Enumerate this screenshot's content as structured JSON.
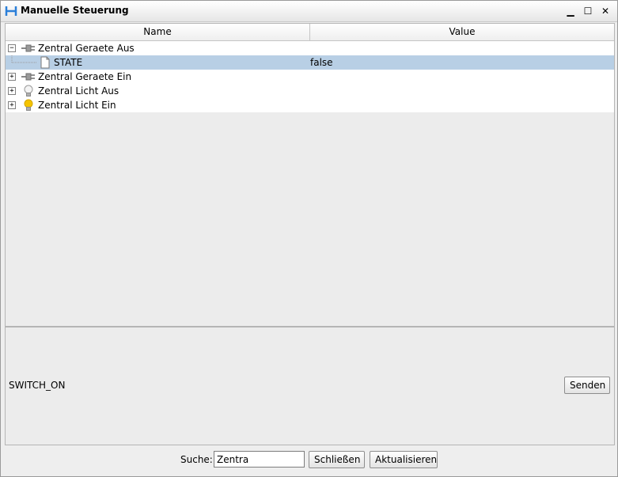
{
  "window": {
    "title": "Manuelle Steuerung",
    "minimize": "▁",
    "maximize": "☐",
    "close": "✕"
  },
  "table": {
    "columns": [
      "Name",
      "Value"
    ],
    "rows": [
      {
        "label": "Zentral Geraete Aus",
        "toggle": "−",
        "icon": "plug-icon",
        "value": ""
      },
      {
        "label": "STATE",
        "toggle": "",
        "icon": "document-icon",
        "value": "false",
        "selected": true
      },
      {
        "label": "Zentral Geraete Ein",
        "toggle": "+",
        "icon": "plug-icon",
        "value": ""
      },
      {
        "label": "Zentral Licht Aus",
        "toggle": "+",
        "icon": "bulb-off-icon",
        "value": ""
      },
      {
        "label": "Zentral Licht Ein",
        "toggle": "+",
        "icon": "bulb-on-icon",
        "value": ""
      }
    ]
  },
  "detail": {
    "label": "SWITCH_ON",
    "send_label": "Senden"
  },
  "bottom": {
    "search_label": "Suche:",
    "search_value": "Zentra",
    "close_label": "Schließen",
    "refresh_label": "Aktualisieren"
  },
  "colors": {
    "selection": "#b8cfe5",
    "bulb_on": "#f5c400"
  }
}
